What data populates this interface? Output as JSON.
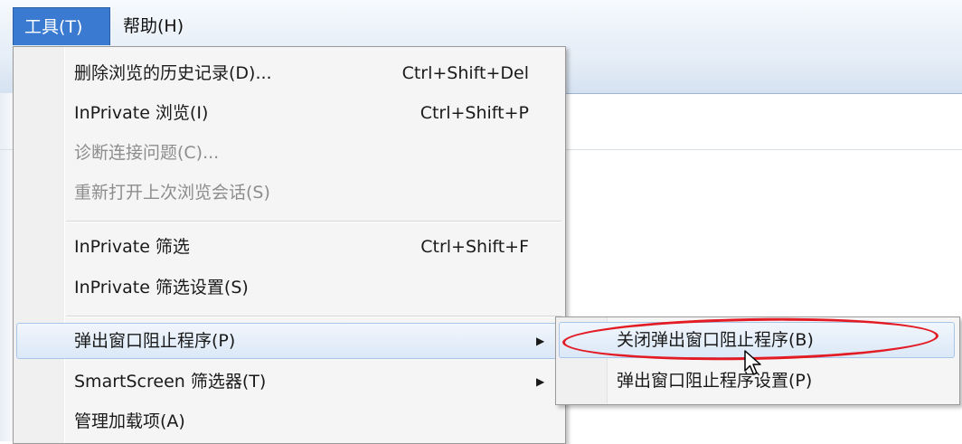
{
  "menubar": {
    "tools_label": "工具(T)",
    "help_label": "帮助(H)"
  },
  "tools_menu": {
    "items": [
      {
        "label": "删除浏览的历史记录(D)...",
        "shortcut": "Ctrl+Shift+Del",
        "enabled": true
      },
      {
        "label": "InPrivate 浏览(I)",
        "shortcut": "Ctrl+Shift+P",
        "enabled": true
      },
      {
        "label": "诊断连接问题(C)...",
        "shortcut": "",
        "enabled": false
      },
      {
        "label": "重新打开上次浏览会话(S)",
        "shortcut": "",
        "enabled": false
      },
      {
        "label": "InPrivate 筛选",
        "shortcut": "Ctrl+Shift+F",
        "enabled": true
      },
      {
        "label": "InPrivate 筛选设置(S)",
        "shortcut": "",
        "enabled": true
      },
      {
        "label": "弹出窗口阻止程序(P)",
        "shortcut": "",
        "enabled": true,
        "submenu": true
      },
      {
        "label": "SmartScreen 筛选器(T)",
        "shortcut": "",
        "enabled": true,
        "submenu": true
      },
      {
        "label": "管理加载项(A)",
        "shortcut": "",
        "enabled": true
      }
    ],
    "arrow_glyph": "▶"
  },
  "popup_submenu": {
    "items": [
      {
        "label": "关闭弹出窗口阻止程序(B)"
      },
      {
        "label": "弹出窗口阻止程序设置(P)"
      }
    ]
  },
  "colors": {
    "menu_highlight": "#3a7ad1",
    "annotation": "#e21b24"
  }
}
